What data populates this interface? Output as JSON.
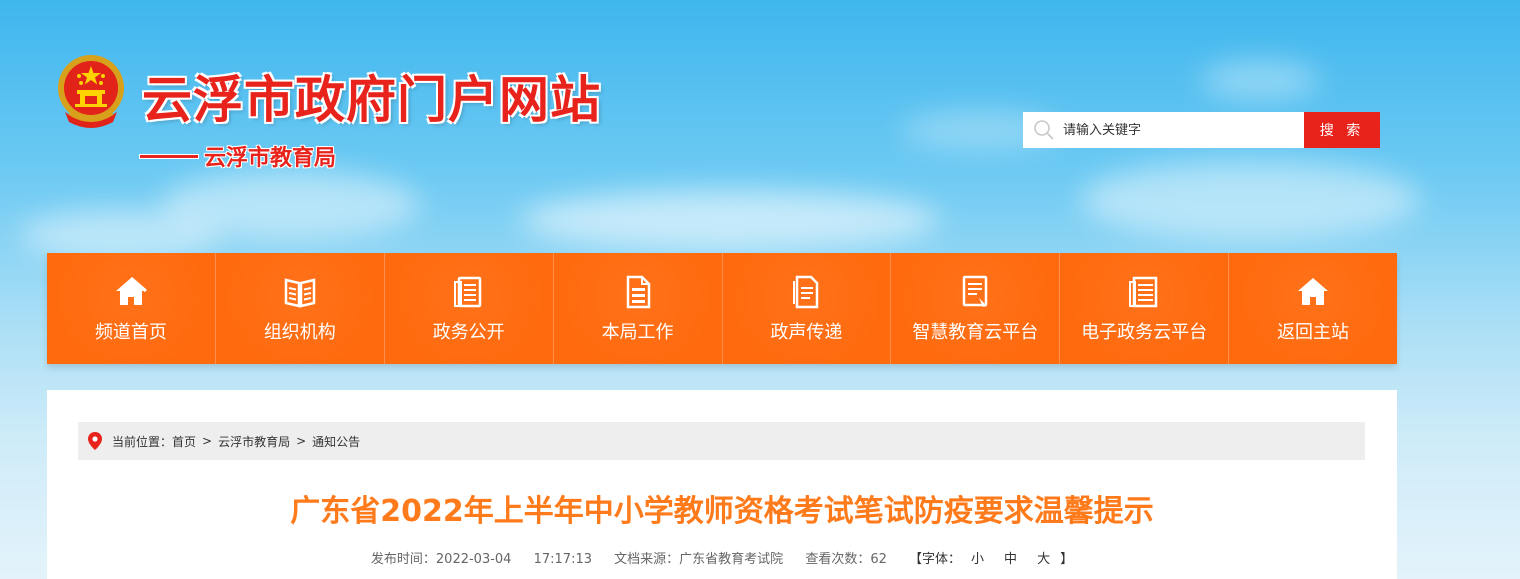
{
  "header": {
    "site_title": "云浮市政府门户网站",
    "department": "云浮市教育局"
  },
  "search": {
    "placeholder": "请输入关键字",
    "button_label": "搜 索"
  },
  "nav": {
    "items": [
      {
        "label": "频道首页",
        "icon": "home-icon"
      },
      {
        "label": "组织机构",
        "icon": "book-icon"
      },
      {
        "label": "政务公开",
        "icon": "document-list-icon"
      },
      {
        "label": "本局工作",
        "icon": "file-icon"
      },
      {
        "label": "政声传递",
        "icon": "notes-icon"
      },
      {
        "label": "智慧教育云平台",
        "icon": "report-icon"
      },
      {
        "label": "电子政务云平台",
        "icon": "ledger-icon"
      },
      {
        "label": "返回主站",
        "icon": "home-icon"
      }
    ]
  },
  "breadcrumb": {
    "prefix": "当前位置：",
    "items": [
      "首页",
      "云浮市教育局",
      "通知公告"
    ],
    "separator": ">"
  },
  "article": {
    "title": "广东省2022年上半年中小学教师资格考试笔试防疫要求温馨提示",
    "publish_label": "发布时间：",
    "publish_date": "2022-03-04",
    "publish_time": "17:17:13",
    "source_label": "文档来源：",
    "source": "广东省教育考试院",
    "views_label": "查看次数：",
    "views": "62",
    "font_label": "【字体：",
    "font_small": "小",
    "font_medium": "中",
    "font_large": "大",
    "font_close": "】"
  },
  "colors": {
    "brand_red": "#e8231c",
    "nav_orange": "#ff6a0e",
    "title_orange": "#ff7a1a"
  }
}
